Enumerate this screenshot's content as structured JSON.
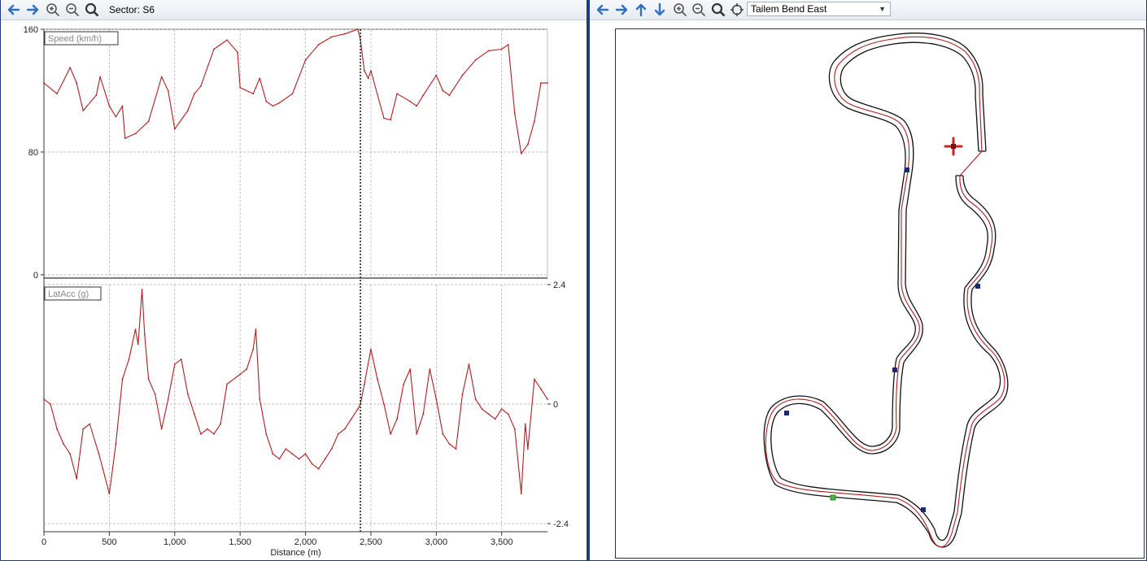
{
  "left_toolbar": {
    "sector_text": "Sector: S6"
  },
  "right_toolbar": {
    "track_name": "Tailem Bend East"
  },
  "icons": {
    "back": "arrow-left-icon",
    "forward": "arrow-right-icon",
    "up": "arrow-up-icon",
    "down": "arrow-down-icon",
    "zoom_in": "zoom-in-icon",
    "zoom_out": "zoom-out-icon",
    "zoom_fit": "magnifier-icon",
    "center": "crosshair-icon"
  },
  "colors": {
    "trace": "#b01e1e",
    "toolbar_icon": "#2f6fc2",
    "marker_blue": "#1a2a7a",
    "marker_green": "#3fbf3f",
    "car_marker": "#d21f1f"
  },
  "chart_data": [
    {
      "type": "line",
      "legend": "Speed (km/h)",
      "y_ticks": [
        "160",
        "80",
        "0"
      ],
      "ylim": [
        0,
        160
      ],
      "xlim": [
        0,
        3850
      ],
      "cursor_x": 2420,
      "series": [
        {
          "x": [
            0,
            100,
            200,
            250,
            300,
            400,
            430,
            500,
            550,
            600,
            620,
            700,
            800,
            900,
            950,
            1000,
            1100,
            1150,
            1200,
            1300,
            1400,
            1480,
            1500,
            1600,
            1650,
            1700,
            1750,
            1800,
            1900,
            2000,
            2100,
            2200,
            2300,
            2400,
            2420,
            2450,
            2480,
            2500,
            2600,
            2650,
            2700,
            2800,
            2850,
            2900,
            3000,
            3050,
            3100,
            3200,
            3300,
            3400,
            3500,
            3550,
            3600,
            3650,
            3700,
            3750,
            3800,
            3850
          ],
          "y": [
            125,
            118,
            135,
            125,
            107,
            117,
            129,
            110,
            103,
            110,
            89,
            92,
            100,
            129,
            120,
            95,
            107,
            118,
            123,
            147,
            153,
            145,
            122,
            118,
            128,
            113,
            110,
            112,
            118,
            140,
            150,
            155,
            157,
            160,
            153,
            133,
            128,
            133,
            102,
            101,
            118,
            113,
            110,
            117,
            130,
            120,
            117,
            130,
            140,
            146,
            147,
            150,
            105,
            79,
            85,
            100,
            125,
            125
          ]
        }
      ]
    },
    {
      "type": "line",
      "legend": "LatAcc (g)",
      "y_ticks": [
        "2.4",
        "0",
        "-2.4"
      ],
      "ylim": [
        -2.4,
        2.4
      ],
      "xlabel": "Distance (m)",
      "x_ticks": [
        "0",
        "500",
        "1,000",
        "1,500",
        "2,000",
        "2,500",
        "3,000",
        "3,500"
      ],
      "xlim": [
        0,
        3850
      ],
      "cursor_x": 2420,
      "series": [
        {
          "x": [
            0,
            50,
            100,
            150,
            200,
            250,
            270,
            300,
            350,
            420,
            450,
            500,
            550,
            600,
            650,
            700,
            720,
            750,
            770,
            800,
            850,
            900,
            950,
            1000,
            1050,
            1100,
            1150,
            1200,
            1250,
            1300,
            1350,
            1400,
            1500,
            1550,
            1600,
            1620,
            1650,
            1700,
            1750,
            1800,
            1850,
            1900,
            1950,
            2000,
            2050,
            2100,
            2150,
            2200,
            2250,
            2300,
            2350,
            2400,
            2420,
            2450,
            2500,
            2550,
            2600,
            2650,
            2700,
            2750,
            2800,
            2850,
            2900,
            2950,
            3000,
            3050,
            3100,
            3150,
            3200,
            3250,
            3300,
            3350,
            3400,
            3450,
            3500,
            3550,
            3600,
            3650,
            3680,
            3700,
            3750,
            3800,
            3850
          ],
          "y": [
            0.1,
            0,
            -0.5,
            -0.8,
            -1.0,
            -1.5,
            -1.1,
            -0.5,
            -0.4,
            -1.0,
            -1.3,
            -1.8,
            -0.8,
            0.5,
            0.9,
            1.5,
            1.2,
            2.3,
            1.4,
            0.5,
            0.2,
            -0.5,
            0.1,
            0.8,
            0.9,
            0.2,
            -0.2,
            -0.6,
            -0.5,
            -0.6,
            -0.4,
            0.4,
            0.6,
            0.7,
            1.1,
            1.5,
            0.1,
            -0.6,
            -1.0,
            -1.1,
            -0.9,
            -1.0,
            -1.1,
            -1.0,
            -1.2,
            -1.3,
            -1.1,
            -0.9,
            -0.6,
            -0.5,
            -0.3,
            -0.1,
            0,
            0.4,
            1.1,
            0.5,
            0,
            -0.6,
            -0.3,
            0.4,
            0.7,
            -0.6,
            -0.2,
            0.7,
            0.1,
            -0.6,
            -0.8,
            -0.9,
            0.2,
            0.8,
            0.1,
            -0.1,
            -0.2,
            -0.3,
            -0.1,
            -0.2,
            -0.5,
            -1.8,
            -0.4,
            -0.9,
            0.5,
            0.3,
            0.1
          ]
        }
      ]
    }
  ]
}
